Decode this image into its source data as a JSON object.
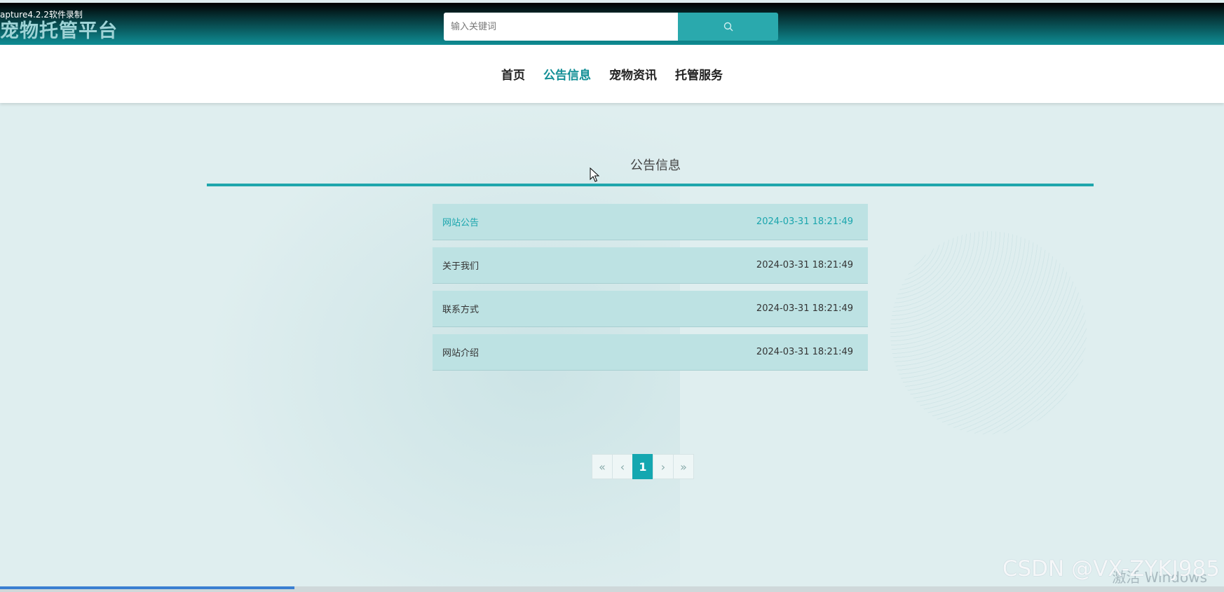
{
  "overlay_caption": "apture4.2.2软件录制",
  "header": {
    "site_title": "宠物托管平台",
    "search_placeholder": "输入关键词",
    "search_icon": "search-icon"
  },
  "nav": {
    "items": [
      {
        "label": "首页",
        "active": false
      },
      {
        "label": "公告信息",
        "active": true
      },
      {
        "label": "宠物资讯",
        "active": false
      },
      {
        "label": "托管服务",
        "active": false
      }
    ]
  },
  "section": {
    "title": "公告信息"
  },
  "notices": [
    {
      "title": "网站公告",
      "time": "2024-03-31 18:21:49"
    },
    {
      "title": "关于我们",
      "time": "2024-03-31 18:21:49"
    },
    {
      "title": "联系方式",
      "time": "2024-03-31 18:21:49"
    },
    {
      "title": "网站介绍",
      "time": "2024-03-31 18:21:49"
    }
  ],
  "pagination": {
    "first": "«",
    "prev": "‹",
    "current": "1",
    "next": "›",
    "last": "»"
  },
  "watermark": "CSDN @VX-ZYKJ985",
  "windows_activate": "激活 Windows",
  "colors": {
    "accent": "#1fa6ac",
    "active_nav": "#138f96",
    "list_bg": "#bde2e3",
    "page_bg": "#dfeeef"
  }
}
